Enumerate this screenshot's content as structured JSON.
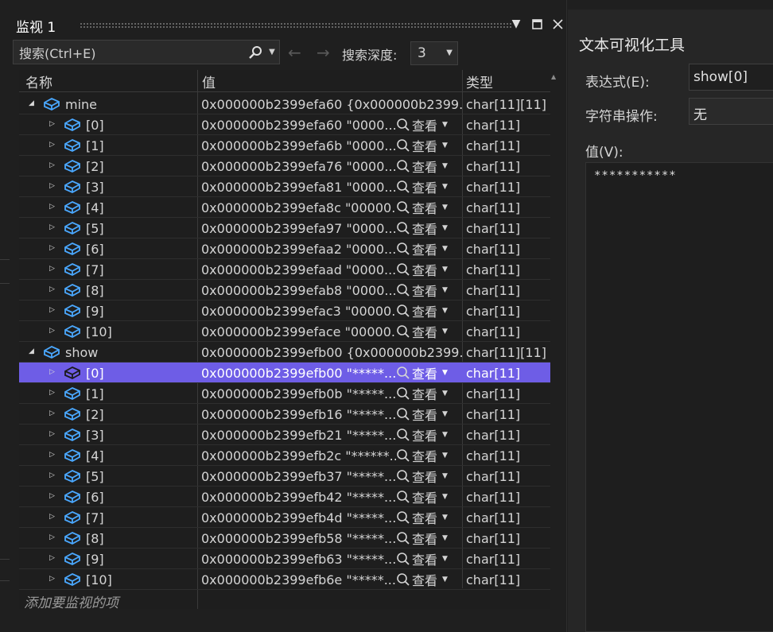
{
  "watch": {
    "title": "监视 1",
    "search_placeholder": "搜索(Ctrl+E)",
    "depth_label": "搜索深度:",
    "depth_value": "3",
    "columns": {
      "name": "名称",
      "value": "值",
      "type": "类型"
    },
    "view_label": "查看",
    "add_item": "添加要监视的项",
    "rows": [
      {
        "name": "mine",
        "value": "0x000000b2399efa60 {0x000000b2399...",
        "type": "char[11][11]",
        "level": 0,
        "expand": "expanded",
        "view": false,
        "selected": false
      },
      {
        "name": "[0]",
        "value": "0x000000b2399efa60 \"0000...",
        "type": "char[11]",
        "level": 1,
        "expand": "collapsed",
        "view": true,
        "selected": false
      },
      {
        "name": "[1]",
        "value": "0x000000b2399efa6b \"0000...",
        "type": "char[11]",
        "level": 1,
        "expand": "collapsed",
        "view": true,
        "selected": false
      },
      {
        "name": "[2]",
        "value": "0x000000b2399efa76 \"0000...",
        "type": "char[11]",
        "level": 1,
        "expand": "collapsed",
        "view": true,
        "selected": false
      },
      {
        "name": "[3]",
        "value": "0x000000b2399efa81 \"0000...",
        "type": "char[11]",
        "level": 1,
        "expand": "collapsed",
        "view": true,
        "selected": false
      },
      {
        "name": "[4]",
        "value": "0x000000b2399efa8c \"00000...",
        "type": "char[11]",
        "level": 1,
        "expand": "collapsed",
        "view": true,
        "selected": false
      },
      {
        "name": "[5]",
        "value": "0x000000b2399efa97 \"0000...",
        "type": "char[11]",
        "level": 1,
        "expand": "collapsed",
        "view": true,
        "selected": false
      },
      {
        "name": "[6]",
        "value": "0x000000b2399efaa2 \"0000...",
        "type": "char[11]",
        "level": 1,
        "expand": "collapsed",
        "view": true,
        "selected": false
      },
      {
        "name": "[7]",
        "value": "0x000000b2399efaad \"0000...",
        "type": "char[11]",
        "level": 1,
        "expand": "collapsed",
        "view": true,
        "selected": false
      },
      {
        "name": "[8]",
        "value": "0x000000b2399efab8 \"0000...",
        "type": "char[11]",
        "level": 1,
        "expand": "collapsed",
        "view": true,
        "selected": false
      },
      {
        "name": "[9]",
        "value": "0x000000b2399efac3 \"00000...",
        "type": "char[11]",
        "level": 1,
        "expand": "collapsed",
        "view": true,
        "selected": false
      },
      {
        "name": "[10]",
        "value": "0x000000b2399eface \"00000...",
        "type": "char[11]",
        "level": 1,
        "expand": "collapsed",
        "view": true,
        "selected": false
      },
      {
        "name": "show",
        "value": "0x000000b2399efb00 {0x000000b2399...",
        "type": "char[11][11]",
        "level": 0,
        "expand": "expanded",
        "view": false,
        "selected": false
      },
      {
        "name": "[0]",
        "value": "0x000000b2399efb00 \"*****...",
        "type": "char[11]",
        "level": 1,
        "expand": "collapsed",
        "view": true,
        "selected": true
      },
      {
        "name": "[1]",
        "value": "0x000000b2399efb0b \"*****...",
        "type": "char[11]",
        "level": 1,
        "expand": "collapsed",
        "view": true,
        "selected": false
      },
      {
        "name": "[2]",
        "value": "0x000000b2399efb16 \"*****...",
        "type": "char[11]",
        "level": 1,
        "expand": "collapsed",
        "view": true,
        "selected": false
      },
      {
        "name": "[3]",
        "value": "0x000000b2399efb21 \"*****...",
        "type": "char[11]",
        "level": 1,
        "expand": "collapsed",
        "view": true,
        "selected": false
      },
      {
        "name": "[4]",
        "value": "0x000000b2399efb2c \"******...",
        "type": "char[11]",
        "level": 1,
        "expand": "collapsed",
        "view": true,
        "selected": false
      },
      {
        "name": "[5]",
        "value": "0x000000b2399efb37 \"*****...",
        "type": "char[11]",
        "level": 1,
        "expand": "collapsed",
        "view": true,
        "selected": false
      },
      {
        "name": "[6]",
        "value": "0x000000b2399efb42 \"*****...",
        "type": "char[11]",
        "level": 1,
        "expand": "collapsed",
        "view": true,
        "selected": false
      },
      {
        "name": "[7]",
        "value": "0x000000b2399efb4d \"*****...",
        "type": "char[11]",
        "level": 1,
        "expand": "collapsed",
        "view": true,
        "selected": false
      },
      {
        "name": "[8]",
        "value": "0x000000b2399efb58 \"*****...",
        "type": "char[11]",
        "level": 1,
        "expand": "collapsed",
        "view": true,
        "selected": false
      },
      {
        "name": "[9]",
        "value": "0x000000b2399efb63 \"*****...",
        "type": "char[11]",
        "level": 1,
        "expand": "collapsed",
        "view": true,
        "selected": false
      },
      {
        "name": "[10]",
        "value": "0x000000b2399efb6e \"*****...",
        "type": "char[11]",
        "level": 1,
        "expand": "collapsed",
        "view": true,
        "selected": false
      }
    ]
  },
  "visualizer": {
    "title": "文本可视化工具",
    "expression_label": "表达式(E):",
    "expression_value": "show[0]",
    "string_op_label": "字符串操作:",
    "string_op_value": "无",
    "value_label": "值(V):",
    "value_text": "***********"
  },
  "colors": {
    "selection": "#6e5de6",
    "icon_blue": "#4aa8ff",
    "background": "#1f1f1f"
  },
  "icons": {
    "search": "search-icon",
    "object": "object-icon",
    "pin": "pin-icon",
    "maximize": "maximize-icon",
    "close": "close-icon"
  }
}
